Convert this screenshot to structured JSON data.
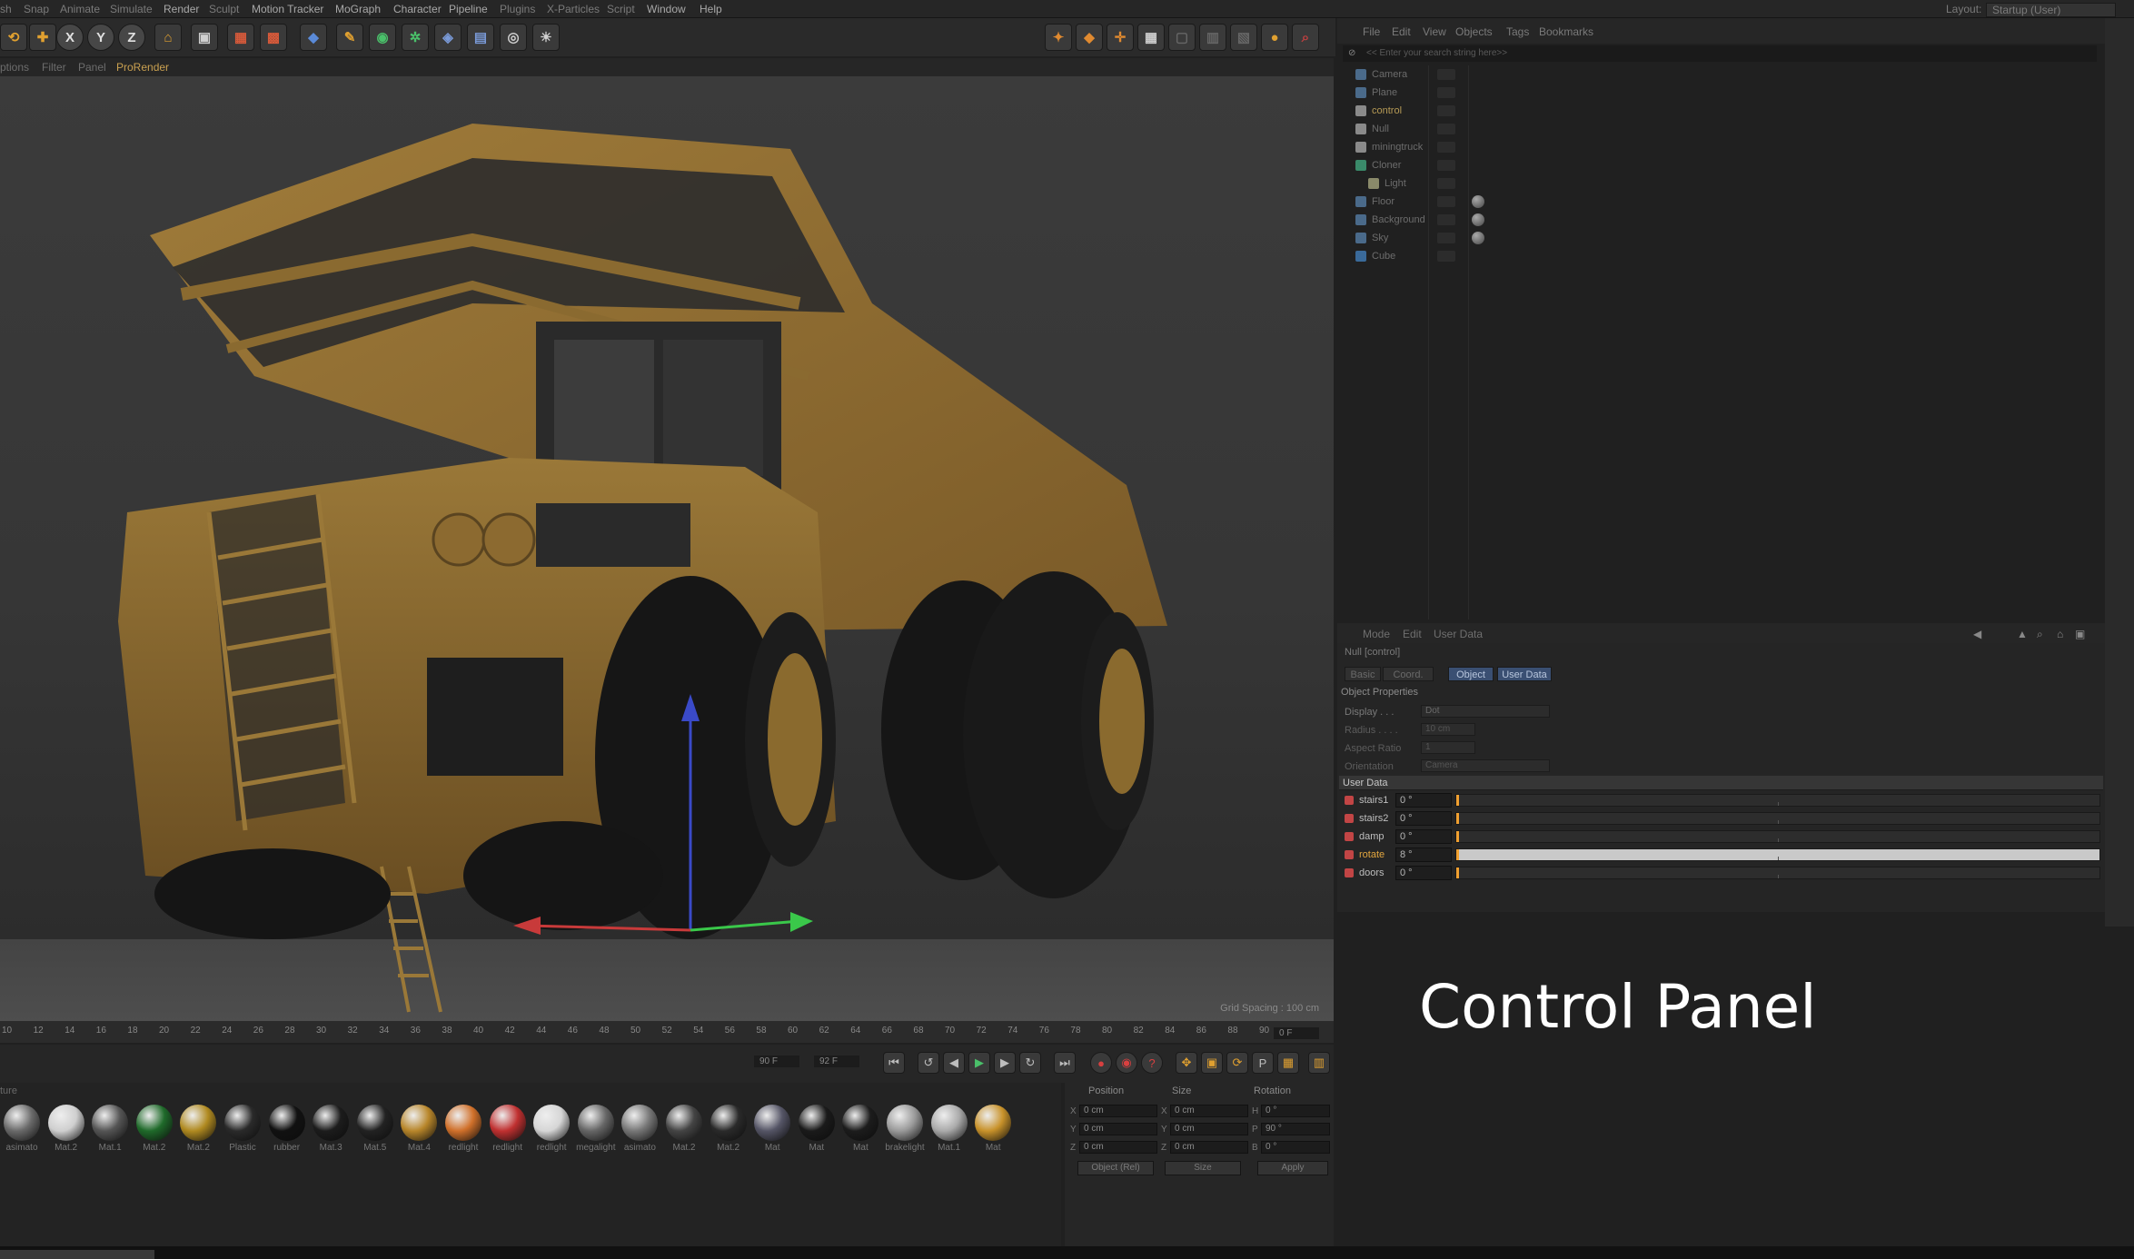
{
  "menubar": {
    "items": [
      "sh",
      "Snap",
      "Animate",
      "Simulate",
      "Render",
      "Sculpt",
      "Motion Tracker",
      "MoGraph",
      "Character",
      "Pipeline",
      "Plugins",
      "X-Particles",
      "Script",
      "Window",
      "Help"
    ],
    "layout_label": "Layout:",
    "layout_value": "Startup (User)"
  },
  "toolbar": {
    "axis_x": "X",
    "axis_y": "Y",
    "axis_z": "Z"
  },
  "viewport_menu": {
    "items": [
      "ptions",
      "Filter",
      "Panel",
      "ProRender"
    ]
  },
  "viewport": {
    "grid_spacing": "Grid Spacing : 100 cm"
  },
  "timeline": {
    "ticks": [
      "10",
      "12",
      "14",
      "16",
      "18",
      "20",
      "22",
      "24",
      "26",
      "28",
      "30",
      "32",
      "34",
      "36",
      "38",
      "40",
      "42",
      "44",
      "46",
      "48",
      "50",
      "52",
      "54",
      "56",
      "58",
      "60",
      "62",
      "64",
      "66",
      "68",
      "70",
      "72",
      "74",
      "76",
      "78",
      "80",
      "82",
      "84",
      "86",
      "88",
      "90"
    ],
    "current_frame": "0 F",
    "end_frame_a": "90 F",
    "end_frame_b": "92 F"
  },
  "materials": {
    "header": "ture",
    "items": [
      "asimato",
      "Mat.2",
      "Mat.1",
      "Mat.2",
      "Mat.2",
      "Plastic",
      "rubber",
      "Mat.3",
      "Mat.5",
      "Mat.4",
      "redlight",
      "redlight",
      "redlight",
      "megalight",
      "asimato",
      "Mat.2",
      "Mat.2",
      "Mat",
      "Mat",
      "Mat",
      "brakelight",
      "Mat.1",
      "Mat"
    ]
  },
  "coordinates": {
    "headers": [
      "Position",
      "Size",
      "Rotation"
    ],
    "rows": [
      {
        "axis": "X",
        "pos": "0 cm",
        "size_axis": "X",
        "size": "0 cm",
        "rot_axis": "H",
        "rot": "0 °"
      },
      {
        "axis": "Y",
        "pos": "0 cm",
        "size_axis": "Y",
        "size": "0 cm",
        "rot_axis": "P",
        "rot": "90 °"
      },
      {
        "axis": "Z",
        "pos": "0 cm",
        "size_axis": "Z",
        "size": "0 cm",
        "rot_axis": "B",
        "rot": "0 °"
      }
    ],
    "mode_select": "Object (Rel)",
    "size_select": "Size",
    "apply_label": "Apply"
  },
  "object_manager": {
    "menu": [
      "File",
      "Edit",
      "View",
      "Objects",
      "Tags",
      "Bookmarks"
    ],
    "search_placeholder": "<< Enter your search string here>>",
    "objects": [
      {
        "name": "Camera",
        "icon_color": "#4a6a8a",
        "highlight": false
      },
      {
        "name": "Plane",
        "icon_color": "#4a6a8a",
        "highlight": false
      },
      {
        "name": "control",
        "icon_color": "#8a8a8a",
        "highlight": true
      },
      {
        "name": "Null",
        "icon_color": "#8a8a8a",
        "highlight": false
      },
      {
        "name": "miningtruck",
        "icon_color": "#8a8a8a",
        "highlight": false
      },
      {
        "name": "Cloner",
        "icon_color": "#3a8a6a",
        "highlight": false
      },
      {
        "name": "Light",
        "icon_color": "#8a8a6a",
        "highlight": false
      },
      {
        "name": "Floor",
        "icon_color": "#4a6a8a",
        "highlight": false
      },
      {
        "name": "Background",
        "icon_color": "#4a6a8a",
        "highlight": false
      },
      {
        "name": "Sky",
        "icon_color": "#4a6a8a",
        "highlight": false
      },
      {
        "name": "Cube",
        "icon_color": "#3a6a9a",
        "highlight": false
      }
    ]
  },
  "attribute_manager": {
    "menu": [
      "Mode",
      "Edit",
      "User Data"
    ],
    "title": "Null [control]",
    "tabs": [
      "Basic",
      "Coord.",
      "Object",
      "User Data"
    ],
    "active_tab": "Object",
    "section": "Object Properties",
    "props": [
      {
        "label": "Display . . .",
        "value": "Dot"
      },
      {
        "label": "Radius . . . .",
        "value": "10 cm"
      },
      {
        "label": "Aspect Ratio",
        "value": "1"
      },
      {
        "label": "Orientation",
        "value": "Camera"
      }
    ],
    "user_data_header": "User Data",
    "user_data": [
      {
        "name": "stairs1",
        "value": "0 °",
        "fill": 0.0,
        "highlight": false
      },
      {
        "name": "stairs2",
        "value": "0 °",
        "fill": 0.0,
        "highlight": false
      },
      {
        "name": "damp",
        "value": "0 °",
        "fill": 0.0,
        "highlight": false
      },
      {
        "name": "rotate",
        "value": "8 °",
        "fill": 1.0,
        "highlight": true
      },
      {
        "name": "doors",
        "value": "0 °",
        "fill": 0.0,
        "highlight": false
      }
    ]
  },
  "caption": "Control Panel",
  "colors": {
    "accent_orange": "#e2a63f",
    "tab_active": "#3a4f72",
    "truck_body": "#8a6a2e"
  }
}
